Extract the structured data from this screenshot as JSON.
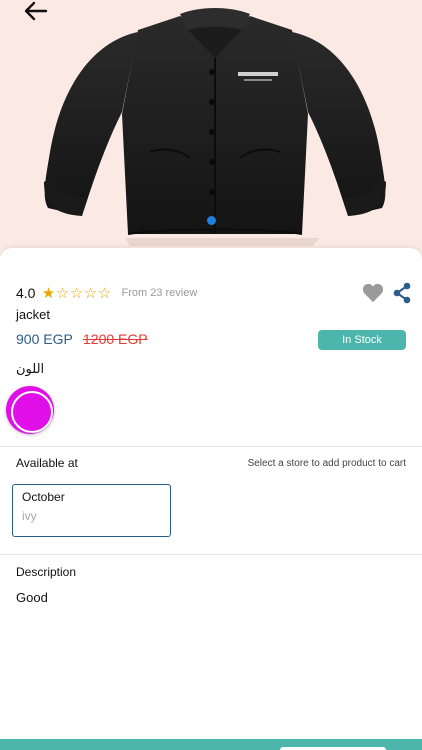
{
  "product": {
    "rating": "4.0",
    "stars_filled": 1,
    "stars_total": 5,
    "reviews_text": "From 23 review",
    "name": "jacket",
    "price": "900 EGP",
    "old_price": "1200 EGP",
    "stock_status": "In Stock",
    "color_label": "اللون",
    "colors": [
      "#e00ee8"
    ]
  },
  "availability": {
    "label": "Available at",
    "hint": "Select a store to add product to cart",
    "stores": [
      {
        "name": "October",
        "sub": "ivy"
      }
    ]
  },
  "description": {
    "label": "Description",
    "text": "Good"
  },
  "theme": {
    "accent": "#4db6ac",
    "price_color": "#2b5d8a",
    "old_price_color": "#e53935",
    "hero_bg": "#fbe9e3"
  },
  "icons": {
    "back": "arrow-left-icon",
    "favorite": "heart-icon",
    "share": "share-icon"
  },
  "gallery": {
    "active_index": 0
  }
}
